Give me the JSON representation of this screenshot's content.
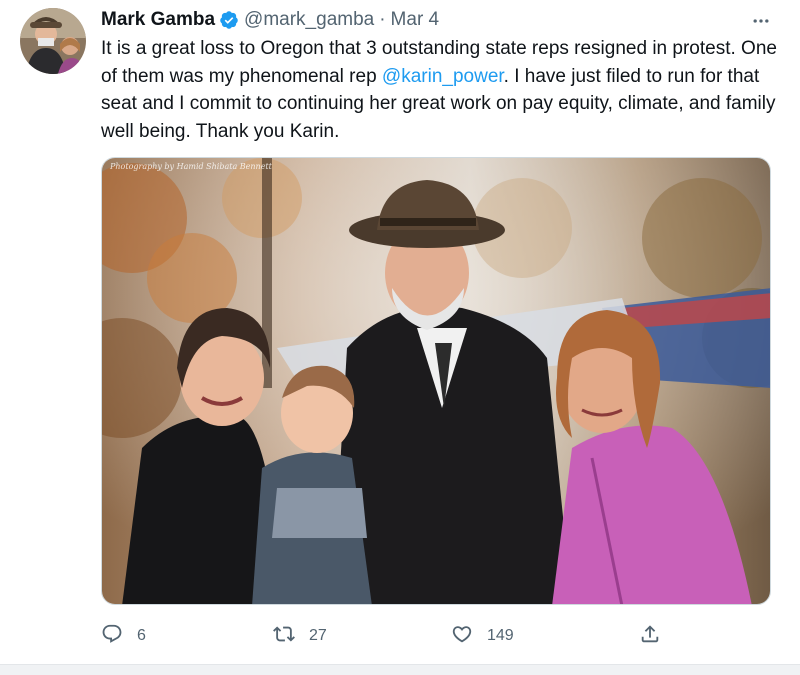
{
  "tweet": {
    "author_name": "Mark Gamba",
    "handle": "@mark_gamba",
    "separator": "·",
    "date": "Mar 4",
    "text_part1": "It is a great loss to Oregon that 3 outstanding state reps resigned in protest. One of them was my phenomenal rep ",
    "mention": "@karin_power",
    "text_part2": ".  I have just filed to run for that seat and I commit to continuing her great work on pay equity, climate, and family well being.  Thank you Karin.",
    "photo_credit": "Photography by Hamid Shibata Bennett"
  },
  "actions": {
    "reply_count": "6",
    "retweet_count": "27",
    "like_count": "149"
  },
  "icons": {
    "verified": "verified-badge-icon",
    "more": "more-options-icon",
    "reply": "reply-icon",
    "retweet": "retweet-icon",
    "like": "like-icon",
    "share": "share-icon"
  },
  "colors": {
    "verified": "#1d9bf0",
    "mention": "#1d9bf0",
    "secondary_text": "#536471"
  }
}
